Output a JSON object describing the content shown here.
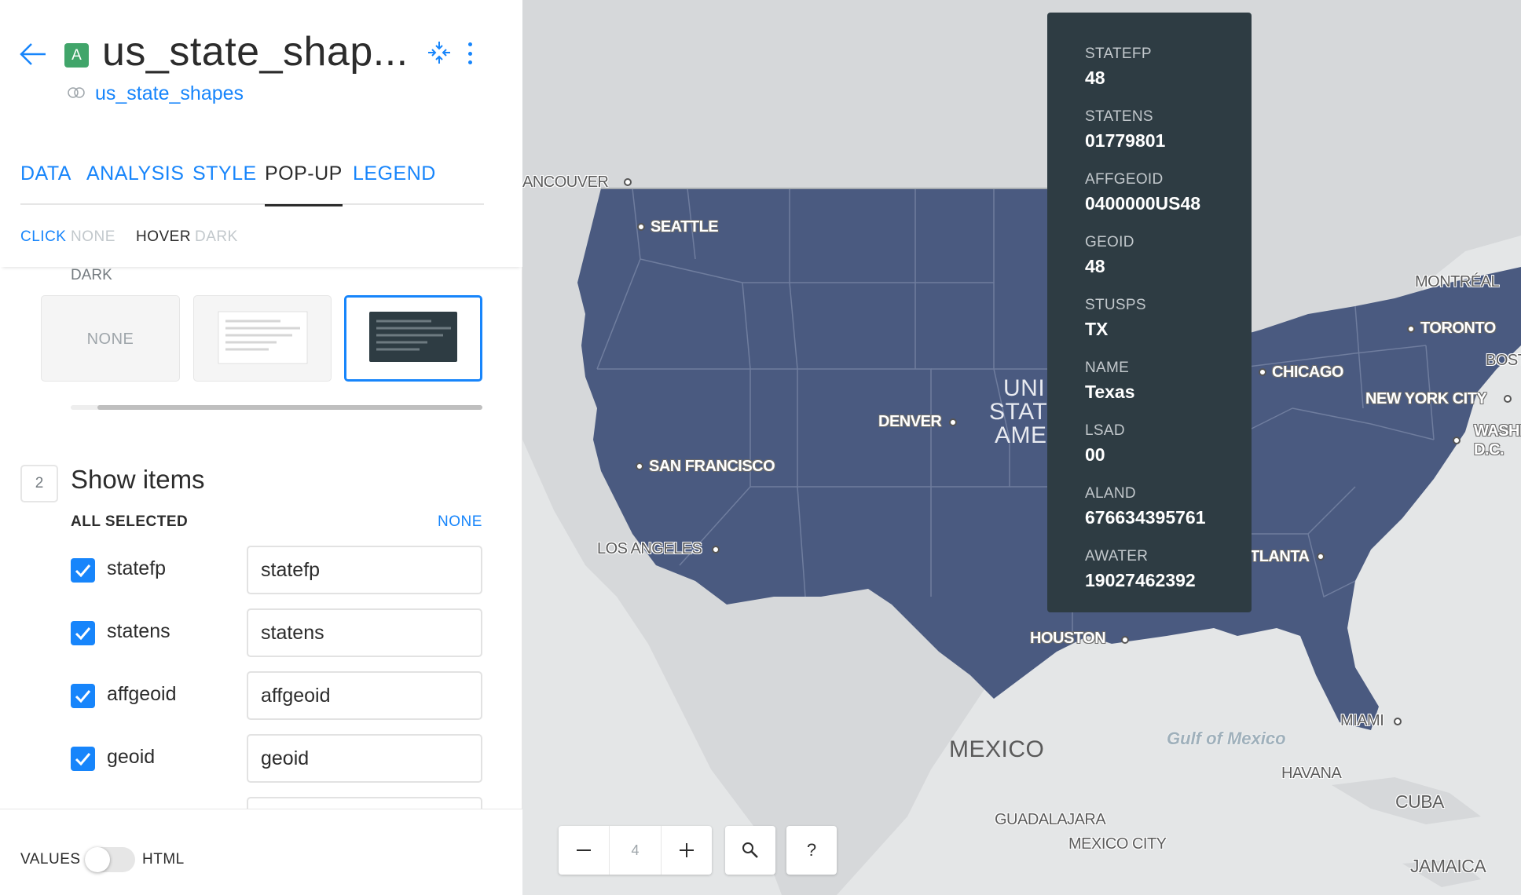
{
  "header": {
    "badge": "A",
    "title": "us_state_shap...",
    "source_name": "us_state_shapes"
  },
  "tabs": [
    {
      "label": "DATA"
    },
    {
      "label": "ANALYSIS"
    },
    {
      "label": "STYLE"
    },
    {
      "label": "POP-UP"
    },
    {
      "label": "LEGEND"
    }
  ],
  "active_tab": "POP-UP",
  "subtabs": {
    "click_label": "CLICK",
    "click_value": "NONE",
    "hover_label": "HOVER",
    "hover_value": "DARK"
  },
  "style_section": {
    "selected_label": "DARK",
    "options": [
      {
        "label": "NONE"
      },
      {
        "icon": "light-popup-icon"
      },
      {
        "icon": "dark-popup-icon"
      }
    ]
  },
  "show_items": {
    "step": "2",
    "title": "Show items",
    "all_selected_label": "ALL SELECTED",
    "none_label": "NONE",
    "items": [
      {
        "label": "statefp",
        "value": "statefp",
        "checked": true
      },
      {
        "label": "statens",
        "value": "statens",
        "checked": true
      },
      {
        "label": "affgeoid",
        "value": "affgeoid",
        "checked": true
      },
      {
        "label": "geoid",
        "value": "geoid",
        "checked": true
      }
    ]
  },
  "footer": {
    "values_label": "VALUES",
    "html_label": "HTML",
    "html_enabled": false
  },
  "map": {
    "zoom": "4",
    "help_label": "?",
    "colors": {
      "states": "#4a5a80",
      "water": "#e4e6e7",
      "land": "#d6d8da"
    },
    "labels": {
      "vancouver": "ANCOUVER",
      "seattle": "SEATTLE",
      "san_francisco": "SAN FRANCISCO",
      "los_angeles": "LOS ANGELES",
      "denver": "DENVER",
      "houston": "HOUSTON",
      "chicago": "CHICAGO",
      "new_york": "NEW YORK CITY",
      "washington": "WASHI",
      "washington_dc": "D.C.",
      "toronto": "TORONTO",
      "montreal": "MONTRÉAL",
      "boston": "BOST",
      "atlanta": "TLANTA",
      "miami": "MIAMI",
      "havana": "HAVANA",
      "cuba": "CUBA",
      "jamaica": "JAMAICA",
      "mexico": "MEXICO",
      "guadalajara": "GUADALAJARA",
      "mexico_city": "MEXICO CITY",
      "gulf": "Gulf of Mexico",
      "usa_line1": "UNI",
      "usa_line2": "STAT",
      "usa_line3": "AME"
    }
  },
  "tooltip": [
    {
      "key": "STATEFP",
      "value": "48"
    },
    {
      "key": "STATENS",
      "value": "01779801"
    },
    {
      "key": "AFFGEOID",
      "value": "0400000US48"
    },
    {
      "key": "GEOID",
      "value": "48"
    },
    {
      "key": "STUSPS",
      "value": "TX"
    },
    {
      "key": "NAME",
      "value": "Texas"
    },
    {
      "key": "LSAD",
      "value": "00"
    },
    {
      "key": "ALAND",
      "value": "676634395761"
    },
    {
      "key": "AWATER",
      "value": "19027462392"
    }
  ]
}
